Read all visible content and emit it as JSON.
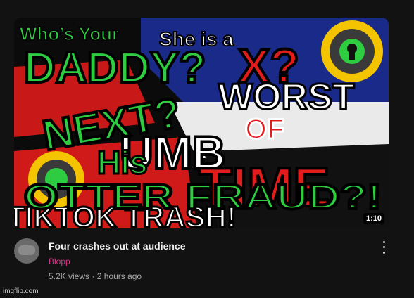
{
  "video": {
    "title": "Four crashes out at audience",
    "channel": "Blopp",
    "views": "5.2K views",
    "separator": "·",
    "posted": "2 hours ago",
    "duration": "1:10"
  },
  "thumbnail": {
    "texts": {
      "who": "Who’s Your",
      "sheis": "She is a",
      "daddy": "DADDY?",
      "xq": "X?",
      "next": "NEXT?",
      "his": "His",
      "otter": "OTTER FRAUD?!",
      "of": "OF",
      "time": "TIME",
      "worst": "WORST",
      "dumb": "UMB",
      "trash": "TIKTOK TRASH!"
    },
    "colors": {
      "green": "#2ecc40",
      "red": "#e21b1b",
      "white": "#ffffff",
      "yellow": "#f5c400"
    }
  },
  "watermark": "imgflip.com"
}
